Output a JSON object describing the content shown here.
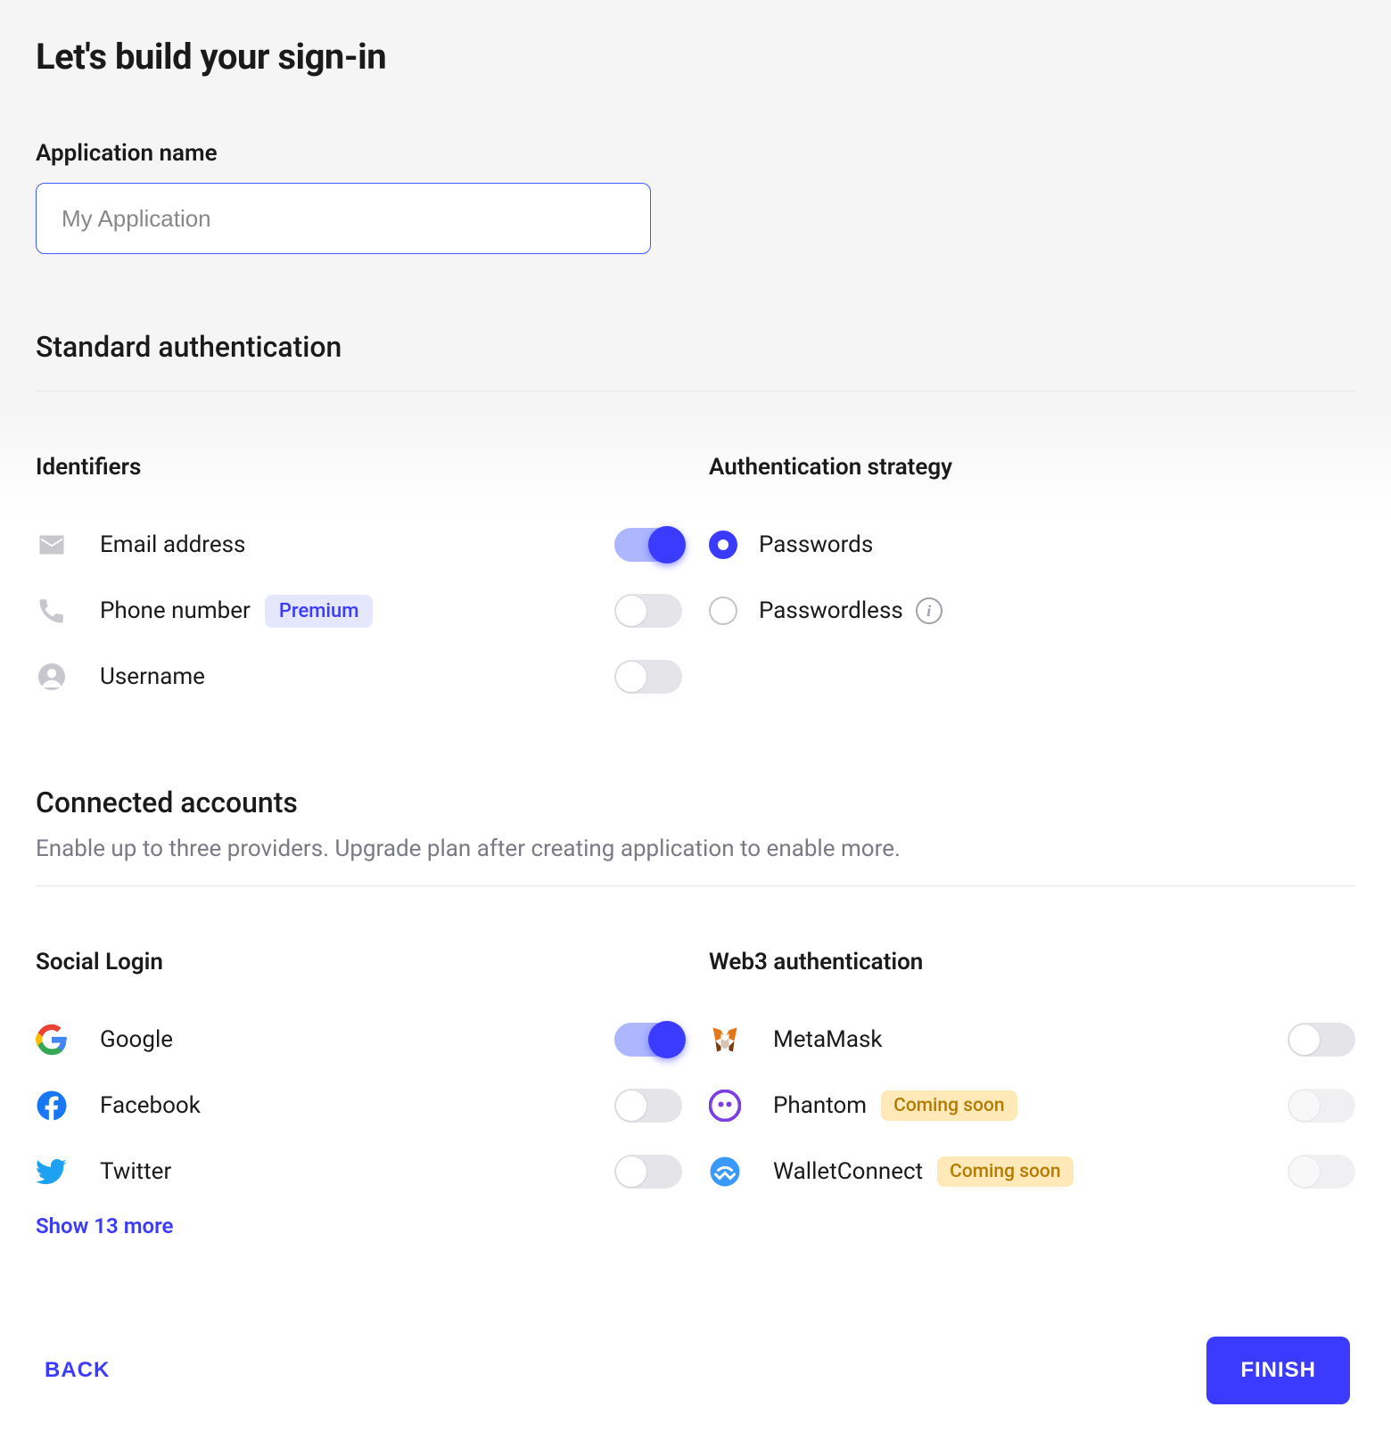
{
  "title": "Let's build your sign-in",
  "appName": {
    "label": "Application name",
    "placeholder": "My Application",
    "value": ""
  },
  "standardAuth": {
    "heading": "Standard authentication",
    "identifiers": {
      "title": "Identifiers",
      "items": [
        {
          "label": "Email address",
          "badge": null,
          "on": true
        },
        {
          "label": "Phone number",
          "badge": "Premium",
          "on": false
        },
        {
          "label": "Username",
          "badge": null,
          "on": false
        }
      ]
    },
    "strategy": {
      "title": "Authentication strategy",
      "options": [
        {
          "label": "Passwords",
          "checked": true,
          "info": false
        },
        {
          "label": "Passwordless",
          "checked": false,
          "info": true
        }
      ]
    }
  },
  "connected": {
    "heading": "Connected accounts",
    "sub": "Enable up to three providers. Upgrade plan after creating application to enable more.",
    "social": {
      "title": "Social Login",
      "items": [
        {
          "label": "Google",
          "on": true
        },
        {
          "label": "Facebook",
          "on": false
        },
        {
          "label": "Twitter",
          "on": false
        }
      ],
      "moreLabel": "Show 13 more"
    },
    "web3": {
      "title": "Web3 authentication",
      "items": [
        {
          "label": "MetaMask",
          "on": false,
          "badge": null,
          "disabled": false
        },
        {
          "label": "Phantom",
          "on": false,
          "badge": "Coming soon",
          "disabled": true
        },
        {
          "label": "WalletConnect",
          "on": false,
          "badge": "Coming soon",
          "disabled": true
        }
      ]
    }
  },
  "footer": {
    "back": "BACK",
    "finish": "FINISH"
  }
}
